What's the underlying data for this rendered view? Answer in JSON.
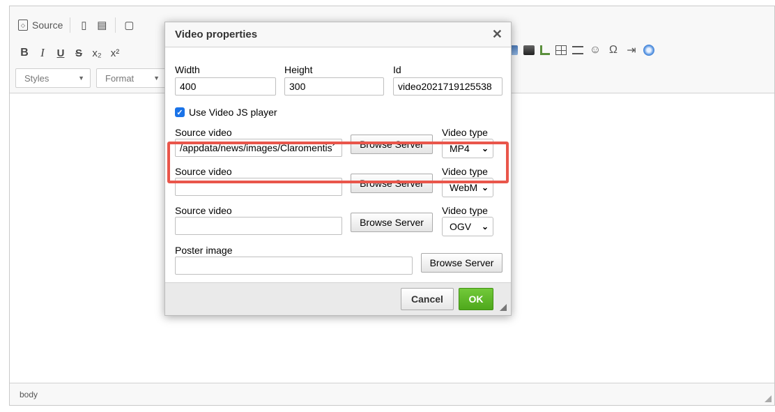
{
  "toolbar": {
    "row1": {
      "source_label": "Source"
    },
    "row2": {
      "bold": "B",
      "italic": "I",
      "underline": "U",
      "strike": "S",
      "subscript": "x₂",
      "superscript": "x²"
    },
    "row3": {
      "styles": "Styles",
      "format": "Format"
    }
  },
  "status_bar": {
    "path": "body"
  },
  "dialog": {
    "title": "Video properties",
    "close_glyph": "✕",
    "width_label": "Width",
    "width_value": "400",
    "height_label": "Height",
    "height_value": "300",
    "id_label": "Id",
    "id_value": "video2021719125538",
    "use_videojs_label": "Use Video JS player",
    "use_videojs_checked": true,
    "sources": [
      {
        "label": "Source video",
        "value": "/appdata/news/images/Claromentis´",
        "browse": "Browse Server",
        "type_label": "Video type",
        "type_value": "MP4"
      },
      {
        "label": "Source video",
        "value": "",
        "browse": "Browse Server",
        "type_label": "Video type",
        "type_value": "WebM"
      },
      {
        "label": "Source video",
        "value": "",
        "browse": "Browse Server",
        "type_label": "Video type",
        "type_value": "OGV"
      }
    ],
    "poster_label": "Poster image",
    "poster_value": "",
    "poster_browse": "Browse Server",
    "cancel": "Cancel",
    "ok": "OK",
    "highlight_color": "#e9564b",
    "ok_color": "#5cb726"
  }
}
